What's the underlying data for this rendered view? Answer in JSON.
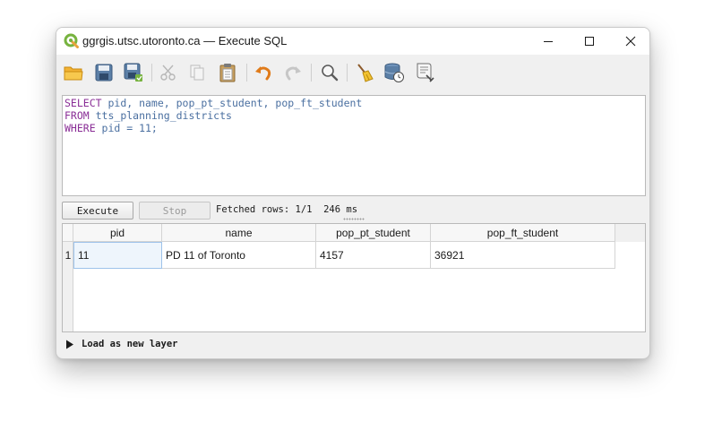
{
  "window": {
    "title": "ggrgis.utsc.utoronto.ca — Execute SQL"
  },
  "toolbar": {
    "icons": [
      "open-folder-icon",
      "save-icon",
      "save-as-icon",
      "cut-icon",
      "copy-icon",
      "paste-icon",
      "undo-icon",
      "redo-icon",
      "find-icon",
      "clear-icon",
      "query-history-icon",
      "query-builder-icon"
    ]
  },
  "editor": {
    "line1_keyword": "SELECT",
    "line1_rest": " pid, name, pop_pt_student, pop_ft_student",
    "line2_keyword": "FROM",
    "line2_rest": " tts_planning_districts",
    "line3_keyword": "WHERE",
    "line3_rest": " pid = 11;"
  },
  "controls": {
    "execute_label": "Execute",
    "stop_label": "Stop",
    "status": "Fetched rows: 1/1  246 ms"
  },
  "results": {
    "columns": [
      "pid",
      "name",
      "pop_pt_student",
      "pop_ft_student"
    ],
    "rows": [
      {
        "row_number": "1",
        "cells": [
          "11",
          "PD 11 of Toronto",
          "4157",
          "36921"
        ]
      }
    ]
  },
  "load_layer": {
    "label": "Load as new layer"
  },
  "colors": {
    "keyword": "#8a2e96",
    "identifier": "#4a6fa0",
    "qgis_green": "#77b33f"
  }
}
